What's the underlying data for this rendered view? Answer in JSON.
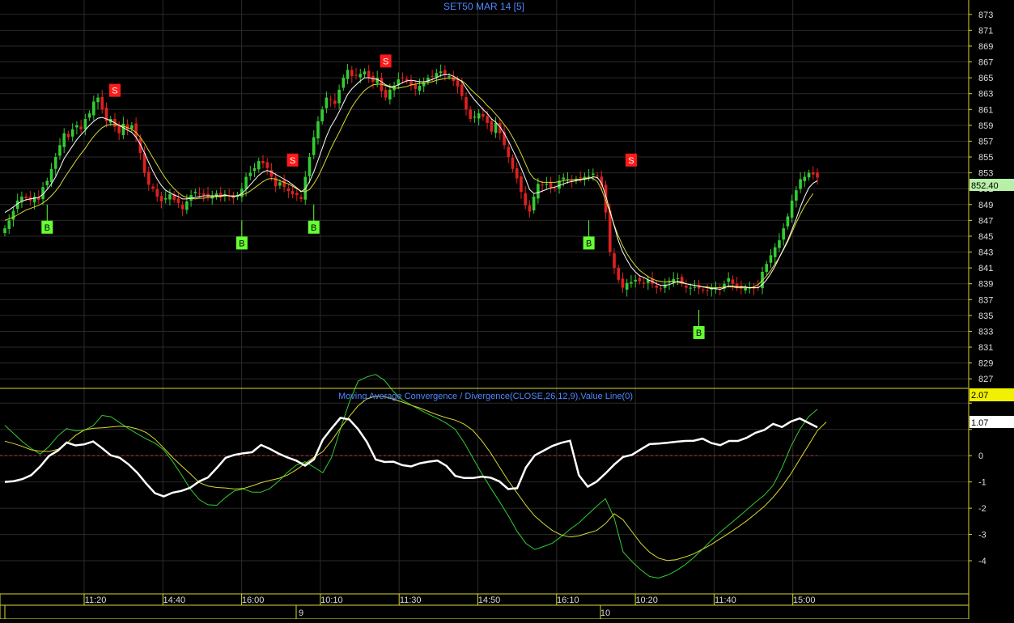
{
  "title": "SET50 MAR 14   [5]",
  "price_label": "852.40",
  "indicator": {
    "title": "Moving Average Convergence / Divergence(CLOSE,26,12,9),Value Line(0)",
    "macd_label": "2.07",
    "signal_label": "1.07"
  },
  "colors": {
    "background": "#000000",
    "grid": "#2a2a2a",
    "up": "#33cc33",
    "down": "#e02020",
    "ma_fast": "#ffffff",
    "ma_slow": "#d8d830",
    "buy": "#66ff33",
    "sell": "#ff1a1a",
    "title": "#4d88ff",
    "value_line": "#cc3333"
  },
  "time_axis": {
    "ticks": [
      "11:20",
      "14:40",
      "16:00",
      "10:10",
      "11:30",
      "14:50",
      "16:10",
      "10:20",
      "11:40",
      "15:00"
    ],
    "days": [
      "9",
      "10"
    ]
  },
  "chart_data": [
    {
      "type": "candlestick",
      "title": "SET50 MAR 14   [5]",
      "ylim": [
        826,
        874
      ],
      "yticks": [
        873,
        871,
        869,
        867,
        865,
        863,
        861,
        859,
        857,
        855,
        853,
        851,
        849,
        847,
        845,
        843,
        841,
        839,
        837,
        835,
        833,
        831,
        829,
        827
      ],
      "last_price": 852.4,
      "close_series": [
        846,
        847,
        848.2,
        849.5,
        850,
        849.8,
        849.5,
        850,
        849.6,
        851.2,
        852,
        853.5,
        855,
        856.5,
        858,
        857.5,
        858.5,
        859,
        858.5,
        859.8,
        860.5,
        862,
        862.5,
        861,
        859.5,
        859.8,
        858.8,
        858,
        859.2,
        858.5,
        859,
        857.5,
        855.5,
        853,
        851.5,
        851,
        850,
        849.4,
        849.8,
        850.3,
        849.6,
        849.2,
        848.4,
        849.4,
        850.2,
        850.6,
        850.4,
        850.2,
        850,
        850.1,
        850.4,
        850,
        850.3,
        850,
        849.8,
        850.2,
        851,
        852.5,
        853,
        853.6,
        854.5,
        854.2,
        853.6,
        852.5,
        851.3,
        851.8,
        851.2,
        850.7,
        850.3,
        850.2,
        849.7,
        852.5,
        855,
        857.5,
        859.5,
        861,
        862.5,
        862.2,
        861.7,
        863.5,
        865,
        866,
        865.2,
        865.3,
        865.5,
        865.8,
        865,
        864.5,
        865,
        863.3,
        862.5,
        863.5,
        864,
        864.8,
        865,
        864.6,
        864,
        863.6,
        864,
        864.4,
        865,
        865.2,
        865.6,
        865.8,
        865.4,
        865.2,
        864.6,
        863.9,
        862.7,
        861,
        859.8,
        860.1,
        860.5,
        860.1,
        859.3,
        858.2,
        859.3,
        858,
        856.5,
        855,
        853.5,
        852.3,
        850.6,
        848.9,
        848.1,
        850,
        851.6,
        851.4,
        851.6,
        851.2,
        851,
        852,
        852.4,
        852.2,
        851.9,
        852.2,
        852.4,
        852.5,
        852.6,
        852.9,
        852.6,
        851.4,
        848,
        843,
        841,
        839.5,
        838.5,
        839.1,
        839.2,
        839.5,
        839.3,
        839.1,
        839.5,
        839,
        838.5,
        838.4,
        838.9,
        839.3,
        839.6,
        839.7,
        839,
        838.5,
        838.5,
        838.6,
        838.4,
        838.2,
        838.1,
        838.5,
        838.4,
        838.3,
        839,
        839.7,
        839,
        838.6,
        838.4,
        838.5,
        838.5,
        838.4,
        838.6,
        840.5,
        841.5,
        842.6,
        843.6,
        844.5,
        846,
        847.5,
        849.5,
        850.8,
        852.2,
        852.5,
        853,
        852.8,
        852.4
      ],
      "ma_fast": [
        848,
        848.3,
        848.7,
        849.1,
        849.4,
        849.6,
        849.7,
        849.8,
        849.9,
        850.3,
        850.9,
        851.6,
        852.5,
        853.6,
        854.8,
        855.6,
        856.4,
        857.2,
        857.8,
        858.4,
        859,
        859.5,
        859.9,
        860,
        859.8,
        859.6,
        859.3,
        859,
        858.7,
        858.4,
        858.1,
        857.5,
        856.6,
        855.5,
        854.3,
        853.2,
        852.2,
        851.4,
        850.8,
        850.5,
        850.2,
        850,
        849.7,
        849.7,
        849.8,
        849.9,
        850,
        850.1,
        850.1,
        850.1,
        850.1,
        850.1,
        850.2,
        850.1,
        850,
        850.1,
        850.4,
        850.9,
        851.5,
        852.1,
        852.7,
        853.1,
        853.3,
        853.1,
        852.8,
        852.5,
        852.2,
        851.9,
        851.5,
        851.1,
        850.6,
        851,
        851.9,
        853.1,
        854.6,
        856.1,
        857.6,
        858.8,
        859.7,
        860.7,
        861.8,
        862.9,
        863.6,
        864.1,
        864.6,
        865,
        865,
        864.9,
        864.8,
        864.5,
        864.1,
        863.9,
        863.9,
        864.1,
        864.4,
        864.6,
        864.7,
        864.6,
        864.5,
        864.5,
        864.6,
        864.8,
        865,
        865.3,
        865.4,
        865.4,
        865.2,
        864.9,
        864.5,
        863.7,
        862.9,
        862.2,
        861.6,
        861,
        860.5,
        859.8,
        859.4,
        858.8,
        858,
        857,
        855.9,
        854.8,
        853.6,
        852.3,
        850.9,
        850.4,
        850.5,
        850.7,
        850.9,
        851.1,
        851.2,
        851.4,
        851.6,
        851.8,
        851.9,
        852,
        852.1,
        852.2,
        852.3,
        852.5,
        852.4,
        851.7,
        850.1,
        848.2,
        846.3,
        844.4,
        843,
        842,
        841.1,
        840.5,
        840,
        839.8,
        839.5,
        839.3,
        839,
        838.8,
        838.8,
        838.9,
        839.1,
        839.3,
        839.2,
        839,
        838.9,
        838.8,
        838.7,
        838.6,
        838.5,
        838.4,
        838.4,
        838.3,
        838.5,
        838.7,
        838.7,
        838.6,
        838.6,
        838.6,
        838.5,
        838.5,
        838.5,
        838.9,
        839.5,
        840.3,
        841.2,
        842.3,
        843.4,
        844.5,
        845.8,
        847.2,
        848.7,
        850,
        851.1,
        851.7,
        852
      ],
      "ma_slow": [
        847,
        847.2,
        847.4,
        847.7,
        848,
        848.3,
        848.5,
        848.7,
        848.9,
        849.2,
        849.6,
        850.1,
        850.7,
        851.4,
        852.3,
        853.1,
        853.9,
        854.7,
        855.4,
        856.1,
        856.9,
        857.6,
        858.2,
        858.7,
        859,
        859.1,
        859.1,
        859,
        858.9,
        858.7,
        858.5,
        858.1,
        857.5,
        856.7,
        855.8,
        854.9,
        854,
        853.1,
        852.3,
        851.6,
        851,
        850.5,
        850.1,
        849.9,
        849.8,
        849.7,
        849.8,
        849.8,
        849.9,
        849.9,
        850,
        850,
        850.1,
        850.1,
        850.1,
        850.1,
        850.2,
        850.4,
        850.7,
        851.1,
        851.5,
        851.9,
        852.2,
        852.3,
        852.2,
        852,
        851.8,
        851.6,
        851.3,
        851,
        850.7,
        850.6,
        850.9,
        851.6,
        852.5,
        853.6,
        854.8,
        856,
        857.1,
        858.1,
        859.2,
        860.3,
        861.3,
        862.1,
        862.8,
        863.4,
        863.8,
        864.1,
        864.2,
        864.2,
        864,
        863.8,
        863.7,
        863.7,
        863.8,
        863.9,
        864.1,
        864.2,
        864.3,
        864.3,
        864.4,
        864.5,
        864.7,
        864.8,
        864.9,
        865,
        864.9,
        864.8,
        864.6,
        864.2,
        863.6,
        863.1,
        862.6,
        862.1,
        861.5,
        861,
        860.4,
        859.8,
        859.1,
        858.4,
        857.5,
        856.5,
        855.4,
        854.2,
        853,
        852.3,
        852,
        851.8,
        851.8,
        851.8,
        851.8,
        851.9,
        852,
        852.1,
        852.1,
        852.2,
        852.2,
        852.3,
        852.4,
        852.3,
        851.9,
        850.9,
        849.5,
        848,
        846.4,
        845,
        843.8,
        842.8,
        842,
        841.3,
        840.7,
        840.3,
        839.9,
        839.6,
        839.4,
        839.3,
        839.2,
        839.3,
        839.3,
        839.2,
        839.1,
        839,
        838.9,
        838.8,
        838.7,
        838.6,
        838.6,
        838.5,
        838.5,
        838.5,
        838.6,
        838.6,
        838.6,
        838.5,
        838.5,
        838.5,
        838.5,
        838.6,
        838.9,
        839.4,
        840,
        840.7,
        841.5,
        842.3,
        843.3,
        844.3,
        845.5,
        846.7,
        847.8,
        848.8,
        849.6,
        850.4
      ],
      "signals": [
        {
          "type": "B",
          "bar": 10,
          "price": 849
        },
        {
          "type": "S",
          "bar": 26,
          "price": 862.6
        },
        {
          "type": "B",
          "bar": 56,
          "price": 847
        },
        {
          "type": "S",
          "bar": 68,
          "price": 853.8
        },
        {
          "type": "B",
          "bar": 73,
          "price": 849
        },
        {
          "type": "S",
          "bar": 90,
          "price": 866.3
        },
        {
          "type": "B",
          "bar": 138,
          "price": 847
        },
        {
          "type": "S",
          "bar": 148,
          "price": 853.8
        },
        {
          "type": "B",
          "bar": 164,
          "price": 835.7
        }
      ]
    },
    {
      "type": "line",
      "title": "Moving Average Convergence / Divergence(CLOSE,26,12,9),Value Line(0)",
      "ylim": [
        -5.2,
        2.5
      ],
      "yticks": [
        2,
        1,
        0,
        -1,
        -2,
        -3,
        -4
      ],
      "series": [
        {
          "name": "MACD",
          "color": "#33cc33",
          "values": [
            1.15,
            0.84,
            0.53,
            0.27,
            0.06,
            0.35,
            0.75,
            1.03,
            0.94,
            0.97,
            1.14,
            1.53,
            1.48,
            1.26,
            1.03,
            0.83,
            0.64,
            0.48,
            0.22,
            -0.22,
            -0.73,
            -1.27,
            -1.67,
            -1.87,
            -1.89,
            -1.59,
            -1.34,
            -1.27,
            -1.39,
            -1.39,
            -1.25,
            -0.97,
            -0.64,
            -0.36,
            -0.23,
            -0.44,
            -0.65,
            -0.06,
            1.02,
            2.03,
            2.84,
            3.0,
            3.09,
            2.86,
            2.44,
            2.12,
            1.93,
            1.75,
            1.57,
            1.42,
            1.23,
            1.0,
            0.5,
            -0.09,
            -0.68,
            -1.22,
            -1.74,
            -2.28,
            -2.88,
            -3.34,
            -3.57,
            -3.46,
            -3.33,
            -3.08,
            -2.8,
            -2.56,
            -2.24,
            -1.93,
            -1.64,
            -2.38,
            -3.66,
            -4.03,
            -4.34,
            -4.6,
            -4.66,
            -4.55,
            -4.38,
            -4.16,
            -3.88,
            -3.56,
            -3.22,
            -2.91,
            -2.63,
            -2.35,
            -2.06,
            -1.77,
            -1.5,
            -1.13,
            -0.46,
            0.35,
            0.99,
            1.48,
            1.77
          ]
        },
        {
          "name": "Signal",
          "color": "#d8d830",
          "values": [
            0.55,
            0.46,
            0.35,
            0.22,
            0.17,
            0.16,
            0.24,
            0.47,
            0.77,
            0.98,
            1.04,
            1.06,
            1.09,
            1.12,
            1.1,
            1.02,
            0.88,
            0.63,
            0.29,
            -0.07,
            -0.39,
            -0.69,
            -1.02,
            -1.16,
            -1.21,
            -1.23,
            -1.27,
            -1.25,
            -1.15,
            -1.03,
            -0.94,
            -0.87,
            -0.74,
            -0.54,
            -0.3,
            -0.06,
            0.15,
            0.57,
            1.05,
            1.49,
            1.9,
            2.16,
            2.27,
            2.24,
            2.15,
            2.04,
            1.92,
            1.81,
            1.68,
            1.55,
            1.44,
            1.35,
            1.2,
            0.96,
            0.57,
            0.11,
            -0.43,
            -0.95,
            -1.42,
            -1.89,
            -2.3,
            -2.59,
            -2.85,
            -3.02,
            -3.1,
            -3.05,
            -2.95,
            -2.85,
            -2.59,
            -2.21,
            -2.44,
            -2.89,
            -3.33,
            -3.68,
            -3.9,
            -3.99,
            -3.96,
            -3.86,
            -3.74,
            -3.56,
            -3.38,
            -3.16,
            -2.95,
            -2.72,
            -2.48,
            -2.21,
            -1.93,
            -1.58,
            -1.17,
            -0.69,
            -0.14,
            0.4,
            0.95,
            1.28
          ]
        },
        {
          "name": "Line",
          "color": "#ffffff",
          "values": [
            -1,
            -0.97,
            -0.89,
            -0.74,
            -0.41,
            -0.01,
            0.19,
            0.5,
            0.39,
            0.43,
            0.54,
            0.29,
            0.01,
            -0.08,
            -0.33,
            -0.65,
            -1.06,
            -1.43,
            -1.55,
            -1.41,
            -1.34,
            -1.22,
            -0.98,
            -0.83,
            -0.47,
            -0.08,
            0.03,
            0.09,
            0.13,
            0.41,
            0.26,
            0.08,
            -0.07,
            -0.19,
            -0.38,
            -0.14,
            0.61,
            1.04,
            1.44,
            1.38,
            1.01,
            0.52,
            -0.15,
            -0.24,
            -0.23,
            -0.36,
            -0.41,
            -0.29,
            -0.23,
            -0.19,
            -0.39,
            -0.77,
            -0.85,
            -0.85,
            -0.8,
            -0.84,
            -0.98,
            -1.27,
            -1.24,
            -0.45,
            0.01,
            0.19,
            0.37,
            0.49,
            0.57,
            -0.74,
            -1.18,
            -0.99,
            -0.68,
            -0.34,
            -0.05,
            0.03,
            0.24,
            0.44,
            0.46,
            0.49,
            0.53,
            0.56,
            0.57,
            0.65,
            0.48,
            0.4,
            0.56,
            0.56,
            0.68,
            0.87,
            0.98,
            1.21,
            1.09,
            1.3,
            1.42,
            1.25,
            1.08
          ]
        }
      ],
      "zero_line": 0
    }
  ]
}
